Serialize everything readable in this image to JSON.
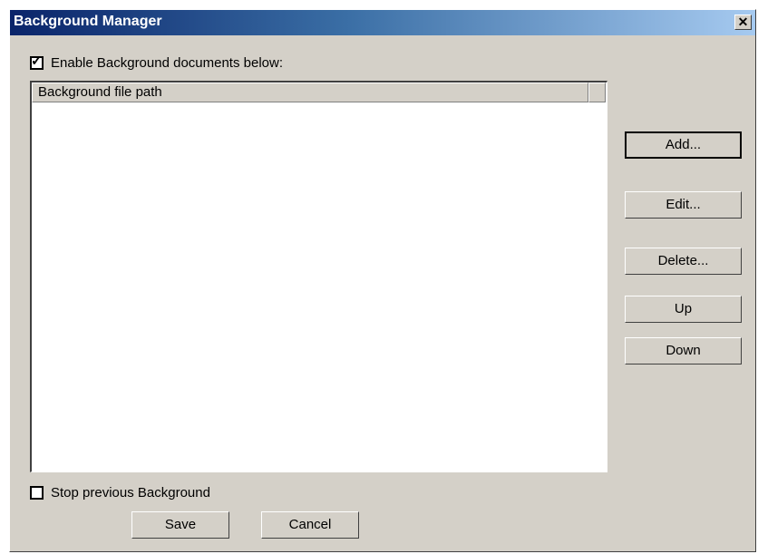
{
  "window": {
    "title": "Background Manager",
    "close_glyph": "✕"
  },
  "enable_checkbox": {
    "label": "Enable Background documents below:",
    "checked": true,
    "check_glyph": "✓"
  },
  "list": {
    "columns": [
      "Background file path"
    ],
    "rows": []
  },
  "side_buttons": {
    "add": "Add...",
    "edit": "Edit...",
    "delete": "Delete...",
    "up": "Up",
    "down": "Down"
  },
  "stop_checkbox": {
    "label": "Stop previous Background",
    "checked": false
  },
  "footer_buttons": {
    "save": "Save",
    "cancel": "Cancel"
  }
}
